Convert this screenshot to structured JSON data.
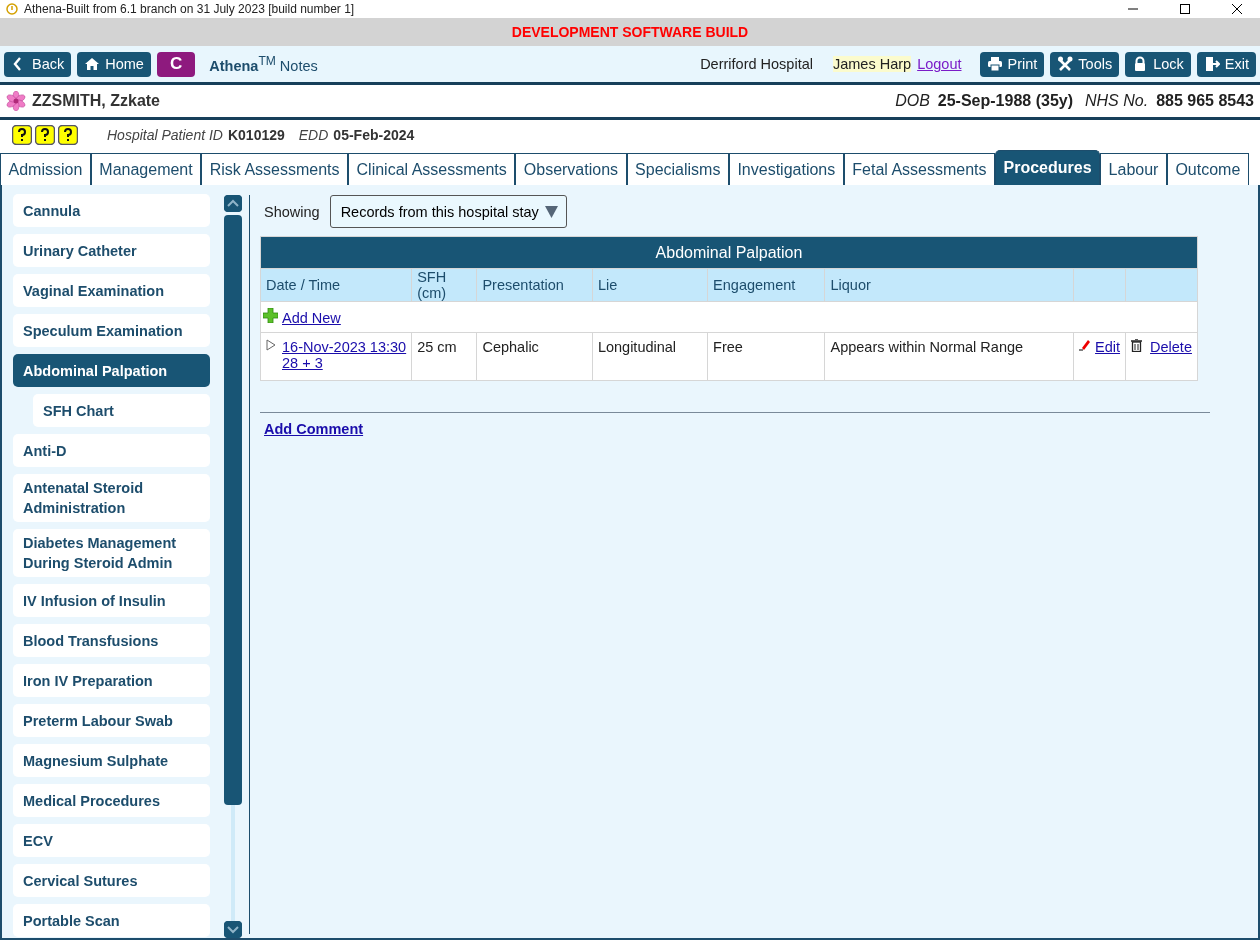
{
  "window": {
    "title": "Athena-Built from 6.1 branch on 31 July 2023 [build number 1]"
  },
  "banner": "DEVELOPMENT SOFTWARE BUILD",
  "toolbar": {
    "left_buttons": [
      {
        "kind": "back",
        "label": "Back"
      },
      {
        "kind": "home",
        "label": "Home"
      },
      {
        "kind": "letter",
        "label": "C"
      }
    ],
    "app_name": "**Athena**$^{TM}$ Notes",
    "hospital": "Derriford Hospital",
    "user": "James Harp",
    "logout": "Logout",
    "right_buttons": [
      {
        "kind": "print",
        "label": "Print"
      },
      {
        "kind": "tools",
        "label": "Tools"
      },
      {
        "kind": "lock",
        "label": "Lock"
      },
      {
        "kind": "exit",
        "label": "Exit"
      }
    ]
  },
  "patient": {
    "name": "ZZSMITH, Zzkate",
    "dob_label": "DOB",
    "dob": "25-Sep-1988 (35y)",
    "nhs_label": "NHS No.",
    "nhs": "885 965 8543",
    "id_label": "Hospital Patient ID",
    "id": "K010129",
    "edd_label": "EDD",
    "edd": "05-Feb-2024"
  },
  "tabs": [
    {
      "label": "Admission",
      "selected": false
    },
    {
      "label": "Management",
      "selected": false
    },
    {
      "label": "Risk Assessments",
      "selected": false
    },
    {
      "label": "Clinical Assessments",
      "selected": false
    },
    {
      "label": "Observations",
      "selected": false
    },
    {
      "label": "Specialisms",
      "selected": false
    },
    {
      "label": "Investigations",
      "selected": false
    },
    {
      "label": "Fetal Assessments",
      "selected": false
    },
    {
      "label": "Procedures",
      "selected": true
    },
    {
      "label": "Labour",
      "selected": false
    },
    {
      "label": "Outcome",
      "selected": false
    }
  ],
  "sidebar": {
    "items": [
      {
        "label": "Cannula",
        "selected": false
      },
      {
        "label": "Urinary Catheter",
        "selected": false
      },
      {
        "label": "Vaginal Examination",
        "selected": false
      },
      {
        "label": "Speculum Examination",
        "selected": false
      },
      {
        "label": "Abdominal Palpation",
        "selected": true,
        "children": [
          {
            "label": "SFH Chart",
            "selected": false
          }
        ]
      },
      {
        "label": "Anti-D",
        "selected": false
      },
      {
        "label": "Antenatal Steroid Administration",
        "selected": false
      },
      {
        "label": "Diabetes Management During Steroid Admin",
        "selected": false
      },
      {
        "label": "IV Infusion of Insulin",
        "selected": false
      },
      {
        "label": "Blood Transfusions",
        "selected": false
      },
      {
        "label": "Iron IV Preparation",
        "selected": false
      },
      {
        "label": "Preterm Labour Swab",
        "selected": false
      },
      {
        "label": "Magnesium Sulphate",
        "selected": false
      },
      {
        "label": "Medical Procedures",
        "selected": false
      },
      {
        "label": "ECV",
        "selected": false
      },
      {
        "label": "Cervical Sutures",
        "selected": false
      },
      {
        "label": "Portable Scan",
        "selected": false
      }
    ]
  },
  "filter": {
    "label": "Showing",
    "value": "Records from this hospital stay"
  },
  "table": {
    "title": "Abdominal Palpation",
    "columns": [
      "Date / Time",
      "SFH (cm)",
      "Presentation",
      "Lie",
      "Engagement",
      "Liquor"
    ],
    "add_new": "Add New",
    "rows": [
      {
        "datetime": "16-Nov-2023 13:30",
        "gestation": "28 + 3",
        "sfh": "25 cm",
        "presentation": "Cephalic",
        "lie": "Longitudinal",
        "engagement": "Free",
        "liquor": "Appears within Normal Range",
        "edit": "Edit",
        "delete": "Delete"
      }
    ]
  },
  "add_comment": "Add Comment"
}
